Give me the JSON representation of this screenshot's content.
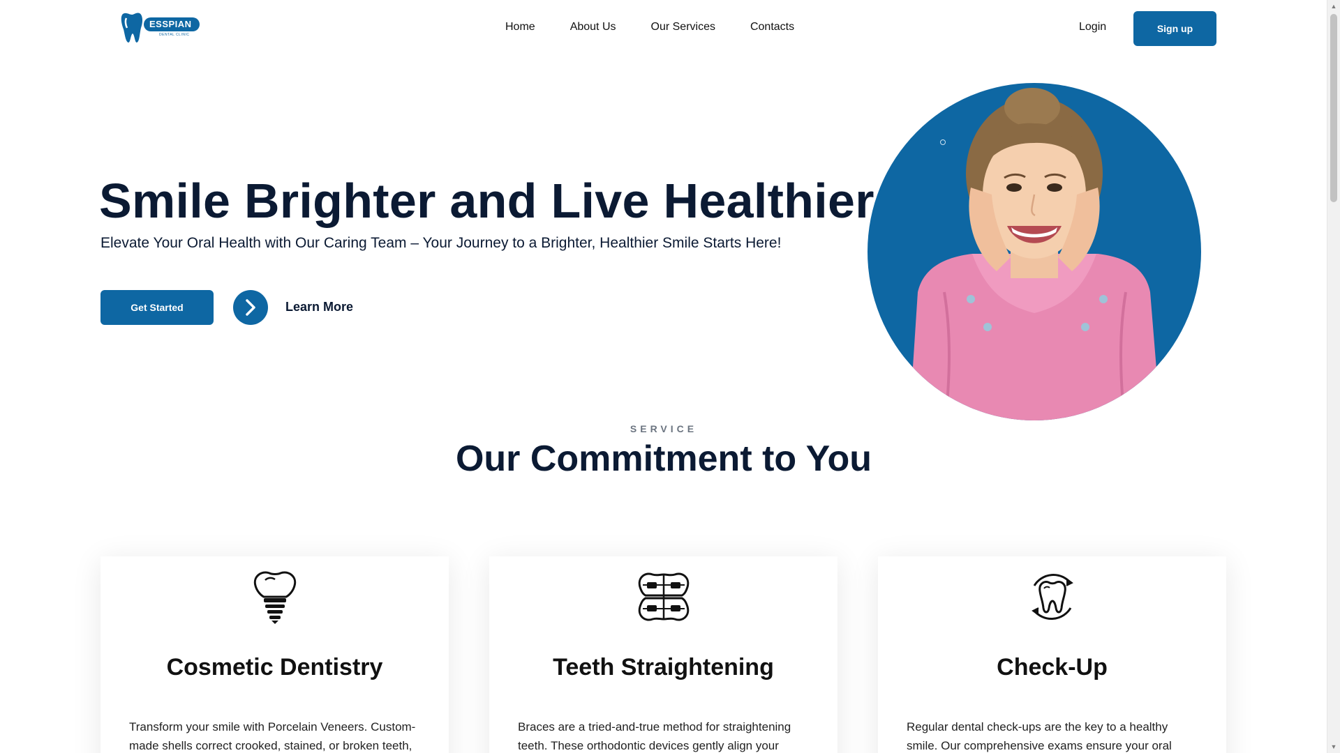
{
  "header": {
    "logo_text": "ESSPIAN",
    "logo_subtext": "DENTAL CLINIC",
    "nav": [
      "Home",
      "About Us",
      "Our Services",
      "Contacts"
    ],
    "login": "Login",
    "signup": "Sign up"
  },
  "hero": {
    "title": "Smile Brighter and Live Healthier",
    "subtitle": "Elevate Your Oral Health with Our Caring Team – Your Journey to a Brighter, Healthier Smile Starts Here!",
    "cta_primary": "Get Started",
    "cta_secondary": "Learn More"
  },
  "services": {
    "eyebrow": "SERVICE",
    "title": "Our Commitment to You",
    "cards": [
      {
        "icon": "dental-implant-icon",
        "title": "Cosmetic Dentistry",
        "text": "Transform your smile with Porcelain Veneers. Custom-made shells correct crooked, stained, or broken teeth,"
      },
      {
        "icon": "braces-icon",
        "title": "Teeth Straightening",
        "text": "Braces are a tried-and-true method for straightening teeth. These orthodontic devices gently align your"
      },
      {
        "icon": "tooth-checkup-icon",
        "title": "Check-Up",
        "text": "Regular dental check-ups are the key to a healthy smile. Our comprehensive exams ensure your oral"
      }
    ]
  },
  "colors": {
    "brand": "#0e67a3",
    "heading": "#0b1a33",
    "jacket": "#e889b2"
  }
}
